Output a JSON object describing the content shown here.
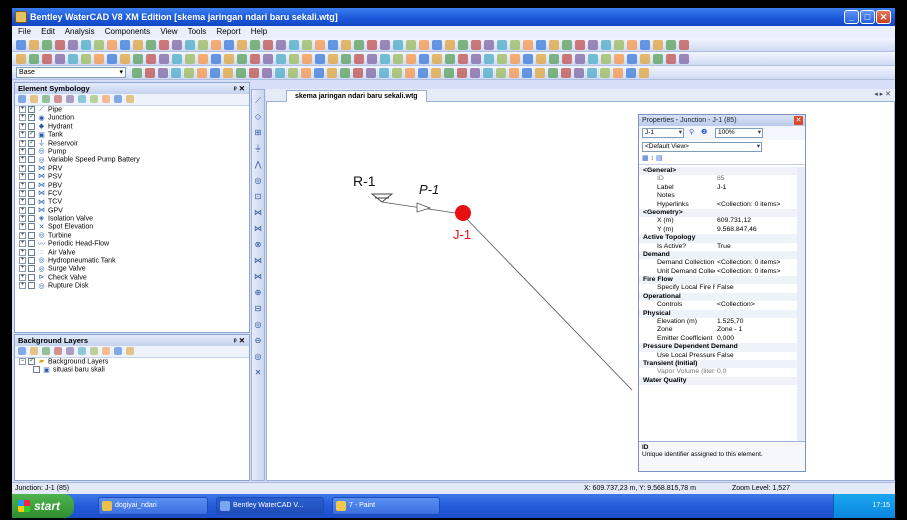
{
  "window": {
    "title": "Bentley WaterCAD V8 XM Edition [skema jaringan ndari baru sekali.wtg]"
  },
  "menu": [
    "File",
    "Edit",
    "Analysis",
    "Components",
    "View",
    "Tools",
    "Report",
    "Help"
  ],
  "toolbar": {
    "scenario_combo": "Base"
  },
  "element_symbology": {
    "title": "Element Symbology",
    "items": [
      {
        "label": "Pipe",
        "checked": true
      },
      {
        "label": "Junction",
        "checked": true
      },
      {
        "label": "Hydrant",
        "checked": false
      },
      {
        "label": "Tank",
        "checked": true
      },
      {
        "label": "Reservoir",
        "checked": true
      },
      {
        "label": "Pump",
        "checked": false
      },
      {
        "label": "Variable Speed Pump Battery",
        "checked": false
      },
      {
        "label": "PRV",
        "checked": false
      },
      {
        "label": "PSV",
        "checked": false
      },
      {
        "label": "PBV",
        "checked": false
      },
      {
        "label": "FCV",
        "checked": false
      },
      {
        "label": "TCV",
        "checked": false
      },
      {
        "label": "GPV",
        "checked": false
      },
      {
        "label": "Isolation Valve",
        "checked": false
      },
      {
        "label": "Spot Elevation",
        "checked": false
      },
      {
        "label": "Turbine",
        "checked": false
      },
      {
        "label": "Periodic Head-Flow",
        "checked": false
      },
      {
        "label": "Air Valve",
        "checked": false
      },
      {
        "label": "Hydropneumatic Tank",
        "checked": false
      },
      {
        "label": "Surge Valve",
        "checked": false
      },
      {
        "label": "Check Valve",
        "checked": false
      },
      {
        "label": "Rupture Disk",
        "checked": false
      }
    ]
  },
  "background_layers": {
    "title": "Background Layers",
    "root": "Background Layers",
    "child": "situasi baru skali"
  },
  "drawing": {
    "tab": "skema jaringan ndari baru sekali.wtg",
    "reservoir_label": "R-1",
    "pipe_label": "P-1",
    "junction_label": "J-1"
  },
  "properties": {
    "title": "Properties - Junction - J-1 (85)",
    "element_combo": "J-1",
    "zoom": "100%",
    "view_combo": "<Default View>",
    "rows": [
      {
        "type": "cat",
        "k": "<General>"
      },
      {
        "k": "ID",
        "v": "85",
        "grey": true
      },
      {
        "k": "Label",
        "v": "J-1"
      },
      {
        "k": "Notes",
        "v": ""
      },
      {
        "k": "Hyperlinks",
        "v": "<Collection: 0 items>"
      },
      {
        "type": "cat",
        "k": "<Geometry>"
      },
      {
        "k": "X (m)",
        "v": "609.731,12"
      },
      {
        "k": "Y (m)",
        "v": "9.568.847,46"
      },
      {
        "type": "cat",
        "k": "Active Topology"
      },
      {
        "k": "Is Active?",
        "v": "True"
      },
      {
        "type": "cat",
        "k": "Demand"
      },
      {
        "k": "Demand Collection",
        "v": "<Collection: 0 items>"
      },
      {
        "k": "Unit Demand Collection",
        "v": "<Collection: 0 items>"
      },
      {
        "type": "cat",
        "k": "Fire Flow"
      },
      {
        "k": "Specify Local Fire Flow",
        "v": "False"
      },
      {
        "type": "cat",
        "k": "Operational"
      },
      {
        "k": "Controls",
        "v": "<Collection>"
      },
      {
        "type": "cat",
        "k": "Physical"
      },
      {
        "k": "Elevation (m)",
        "v": "1.525,70"
      },
      {
        "k": "Zone",
        "v": "Zone - 1"
      },
      {
        "k": "Emitter Coefficient",
        "v": "0,000"
      },
      {
        "type": "cat",
        "k": "Pressure Dependent Demand"
      },
      {
        "k": "Use Local Pressure",
        "v": "False"
      },
      {
        "type": "cat",
        "k": "Transient (Initial)"
      },
      {
        "k": "Vapor Volume (liters)",
        "v": "0,0",
        "grey": true
      },
      {
        "type": "cat",
        "k": "Water Quality"
      }
    ],
    "desc_title": "ID",
    "desc_text": "Unique identifier assigned to this element."
  },
  "status": {
    "left": "Junction: J-1 (85)",
    "coords": "X: 609.737,23 m, Y: 9.568.815,78 m",
    "zoom": "Zoom Level: 1,527"
  },
  "taskbar": {
    "start": "start",
    "tasks": [
      "dogiyai_ndari",
      "Bentley WaterCAD V...",
      "7 - Paint"
    ],
    "clock": "17:15"
  }
}
